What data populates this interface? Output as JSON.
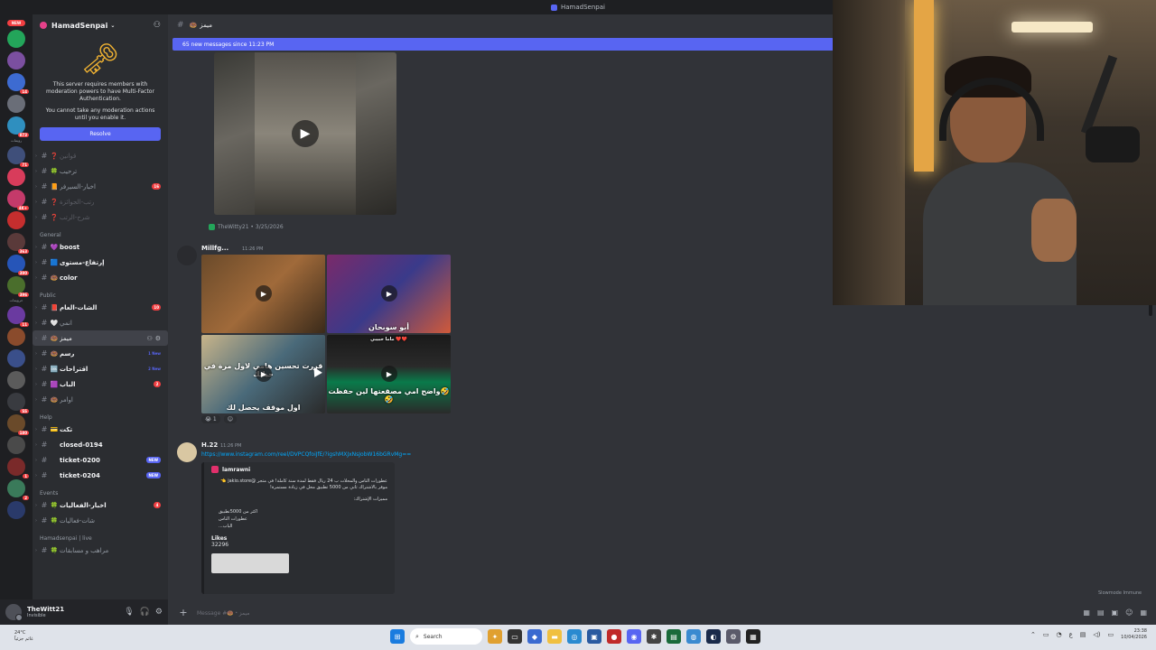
{
  "window": {
    "title": "HamadSenpai"
  },
  "server_rail": {
    "new_label": "NEW",
    "caption_1": "رويمات",
    "caption_2": "حرويمات",
    "servers": [
      {
        "color": "#23a55a",
        "count": ""
      },
      {
        "color": "#7b4fa0",
        "count": ""
      },
      {
        "color": "#3d6bd1",
        "count": "14"
      },
      {
        "color": "#6a6e78",
        "count": ""
      },
      {
        "color": "#2f8fbf",
        "count": "873"
      },
      {
        "color": "#3f4f7a",
        "count": "71"
      },
      {
        "color": "#d83c5b",
        "count": ""
      },
      {
        "color": "#c43a6a",
        "count": "4K+"
      },
      {
        "color": "#c52e2e",
        "count": ""
      },
      {
        "color": "#5a3a3a",
        "count": "363"
      },
      {
        "color": "#2655b8",
        "count": "390"
      },
      {
        "color": "#4a6e2c",
        "count": "396"
      },
      {
        "color": "#6a3aa0",
        "count": "11"
      },
      {
        "color": "#8a4b2c",
        "count": ""
      },
      {
        "color": "#3a4f8a",
        "count": ""
      },
      {
        "color": "#5b5b5b",
        "count": ""
      },
      {
        "color": "#393b40",
        "count": "SS"
      },
      {
        "color": "#6a4a2a",
        "count": "180"
      },
      {
        "color": "#4a4a4a",
        "count": ""
      },
      {
        "color": "#7a2a2a",
        "count": "1"
      },
      {
        "color": "#3a7a5a",
        "count": "2"
      },
      {
        "color": "#2a3a6a",
        "count": ""
      }
    ]
  },
  "sidebar": {
    "server_name": "HamadSenpai",
    "mfa": {
      "line1": "This server requires members with moderation powers to have Multi-Factor Authentication.",
      "line2": "You cannot take any moderation actions until you enable it.",
      "button": "Resolve"
    },
    "top_channels": [
      {
        "emoji": "❓",
        "label": "قوانين",
        "badge": "",
        "muted": true
      },
      {
        "emoji": "🍀",
        "label": "ترحيب",
        "badge": "",
        "muted": false
      },
      {
        "emoji": "📙",
        "label": "اخبار-السيرفر",
        "badge": "16",
        "muted": false
      },
      {
        "emoji": "❓",
        "label": "رتب-الجوائزة",
        "badge": "",
        "muted": true
      },
      {
        "emoji": "❓",
        "label": "شرح-الرتب",
        "badge": "",
        "muted": true
      }
    ],
    "cat_general": "General",
    "general_channels": [
      {
        "emoji": "💜",
        "label": "boost",
        "badge": "",
        "unread": true
      },
      {
        "emoji": "🟦",
        "label": "إرتفاع-مستوى",
        "badge": "",
        "unread": true
      },
      {
        "emoji": "🍩",
        "label": "color",
        "badge": "",
        "unread": true
      }
    ],
    "cat_public": "Public",
    "public_channels": [
      {
        "emoji": "📕",
        "label": "الشات-العام",
        "badge": "10",
        "new": "",
        "active": false
      },
      {
        "emoji": "🤍",
        "label": "انمي",
        "badge": "",
        "new": "",
        "active": false
      },
      {
        "emoji": "🍩",
        "label": "ميمز",
        "badge": "",
        "new": "",
        "active": true
      },
      {
        "emoji": "🍩",
        "label": "رسم",
        "badge": "",
        "new": "1 New",
        "active": false
      },
      {
        "emoji": "🆒",
        "label": "اقتراحات",
        "badge": "",
        "new": "2 New",
        "active": false
      },
      {
        "emoji": "🟪",
        "label": "الباب",
        "badge": "2",
        "new": "",
        "active": false
      },
      {
        "emoji": "🍩",
        "label": "اوامر",
        "badge": "",
        "new": "",
        "active": false
      }
    ],
    "cat_help": "Help",
    "help_channels": [
      {
        "emoji": "💳",
        "label": "تكت",
        "tag": ""
      },
      {
        "emoji": "",
        "label": "closed-0194",
        "tag": ""
      },
      {
        "emoji": "",
        "label": "ticket-0200",
        "tag": "NEW"
      },
      {
        "emoji": "",
        "label": "ticket-0204",
        "tag": "NEW"
      }
    ],
    "cat_events": "Events",
    "event_channels": [
      {
        "emoji": "🍀",
        "label": "اخبار-الفعاليات",
        "badge": "4"
      },
      {
        "emoji": "🍀",
        "label": "شات-فعاليات",
        "badge": ""
      }
    ],
    "cat_live": "Hamadsenpai | live",
    "live_channels": [
      {
        "emoji": "🍀",
        "label": "مراهب و مسابقات"
      }
    ]
  },
  "user_panel": {
    "name": "TheWitt21",
    "status": "Invisible"
  },
  "chat": {
    "channel_name": "ميمز",
    "channel_emoji": "🍩",
    "new_messages_banner": "65 new messages since 11:23 PM",
    "forward_source": "TheWitty21 • 3/25/2026",
    "msg2_author": "Millfg...",
    "msg2_time": "11:26 PM",
    "grid_captions": {
      "cell2": "أبو سوبحان",
      "cell3_top": "قررت تحسين هامي لاول مرة في حياتك",
      "cell3_bottom": "اول موقف يحصل لك",
      "cell4_top": "ماما حبيبي ❤️❤️",
      "cell4_bottom": "واضح امي مصقعتها لين حفظت🤣🤣"
    },
    "reaction_count": "1",
    "msg3_author": "H.22",
    "msg3_time": "11:26 PM",
    "link": "https://www.instagram.com/reel/DVPCQfoiJfE/?igshMXJxNsJobW16bGRvMg==",
    "embed": {
      "author": "lamrawni",
      "description": "عطورات الناس والمحلات ب 24 ريال فقط لمدة سنة كاملة! في متجر @jakio.store 👈 موفر بالاشتراك ثاني من 5000 تطبيق محل في زيادة مستمرة!",
      "sub": "مميزات الإشتراك:",
      "list": [
        "اكثر من 5000تطبيق",
        "عطورات الناس",
        "الباب..."
      ],
      "field_name": "Likes",
      "field_value": "32296"
    },
    "slowmode": "Slowmode Immune",
    "composer_placeholder": "Message #🍩・ميمز"
  },
  "taskbar": {
    "weather_temp": "24°C",
    "weather_text": "غائم جزئياً",
    "search_label": "Search",
    "time": "23:38",
    "date": "10/04/2026"
  },
  "colors": {
    "accent": "#5865f2",
    "danger": "#f23f42",
    "background": "#313338",
    "sidebar": "#2b2d31"
  }
}
